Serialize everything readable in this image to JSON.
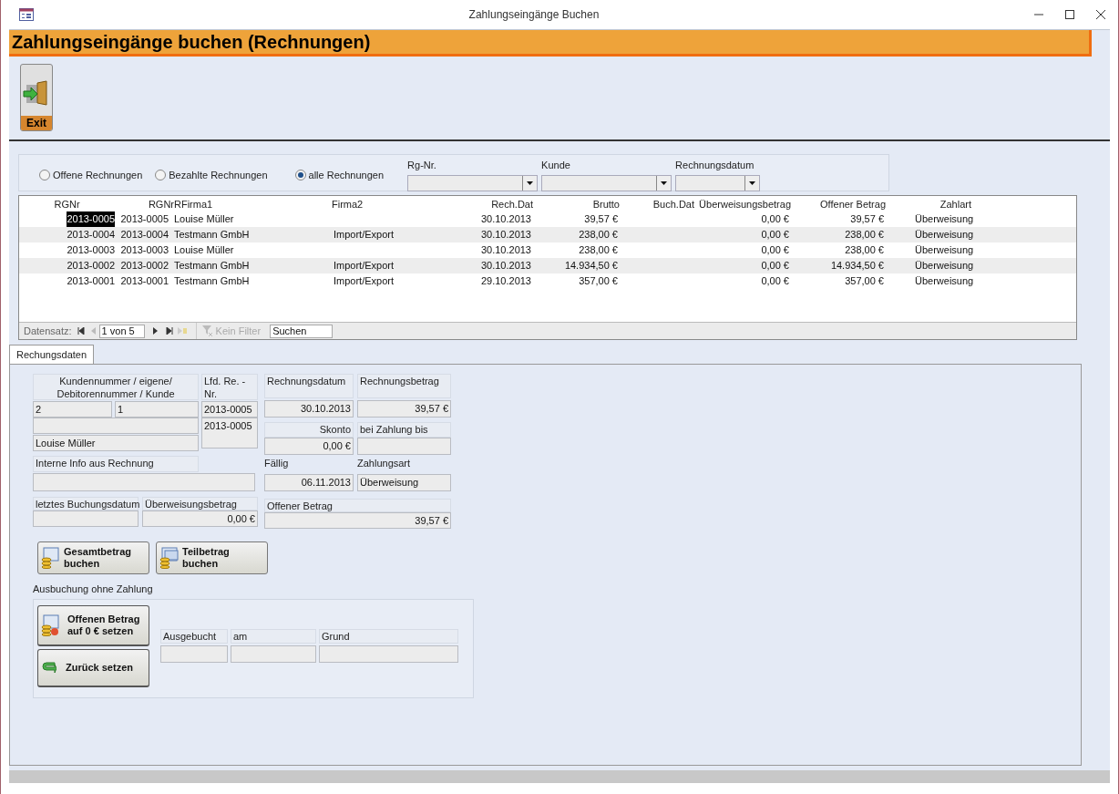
{
  "window": {
    "title": "Zahlungseingänge Buchen"
  },
  "header": {
    "title": "Zahlungseingänge buchen (Rechnungen)"
  },
  "toolbar": {
    "exit_label": "Exit"
  },
  "filter": {
    "radios": [
      {
        "label": "Offene Rechnungen",
        "selected": false
      },
      {
        "label": "Bezahlte Rechnungen",
        "selected": false
      },
      {
        "label": "alle Rechnungen",
        "selected": true
      }
    ],
    "dropdowns": [
      {
        "label": "Rg-Nr."
      },
      {
        "label": "Kunde"
      },
      {
        "label": "Rechnungsdatum"
      }
    ]
  },
  "table": {
    "columns": [
      "RGNr",
      "RGNr",
      "RFirma1",
      "Firma2",
      "Rech.Dat",
      "Brutto",
      "Buch.Dat",
      "Überweisungsbetrag",
      "Offener Betrag",
      "Zahlart"
    ],
    "rows": [
      {
        "selected": true,
        "cells": [
          "2013-0005",
          "2013-0005",
          "Louise Müller",
          "",
          "30.10.2013",
          "39,57 €",
          "",
          "0,00 €",
          "39,57 €",
          "Überweisung"
        ]
      },
      {
        "selected": false,
        "cells": [
          "2013-0004",
          "2013-0004",
          "Testmann GmbH",
          "Import/Export",
          "30.10.2013",
          "238,00 €",
          "",
          "0,00 €",
          "238,00 €",
          "Überweisung"
        ]
      },
      {
        "selected": false,
        "cells": [
          "2013-0003",
          "2013-0003",
          "Louise Müller",
          "",
          "30.10.2013",
          "238,00 €",
          "",
          "0,00 €",
          "238,00 €",
          "Überweisung"
        ]
      },
      {
        "selected": false,
        "cells": [
          "2013-0002",
          "2013-0002",
          "Testmann GmbH",
          "Import/Export",
          "30.10.2013",
          "14.934,50 €",
          "",
          "0,00 €",
          "14.934,50 €",
          "Überweisung"
        ]
      },
      {
        "selected": false,
        "cells": [
          "2013-0001",
          "2013-0001",
          "Testmann GmbH",
          "Import/Export",
          "29.10.2013",
          "357,00 €",
          "",
          "0,00 €",
          "357,00 €",
          "Überweisung"
        ]
      }
    ],
    "navigator": {
      "label": "Datensatz:",
      "position": "1 von 5",
      "filter": "Kein Filter",
      "search_placeholder": "Suchen"
    }
  },
  "tabs": [
    {
      "label": "Rechungsdaten",
      "selected": true
    }
  ],
  "detail": {
    "customer_label": "Kundennummer / eigene/ Debitorennummer / Kunde",
    "customer_number": "2",
    "debtor_number": "1",
    "customer_name": "Louise Müller",
    "invoice_no_label": "Lfd. Re. - Nr.",
    "invoice_no_1": "2013-0005",
    "invoice_no_2": "2013-0005",
    "internal_info_label": "Interne Info aus Rechnung",
    "last_booking_label": "letztes Buchungsdatum",
    "transfer_label": "Überweisungsbetrag",
    "transfer_value": "0,00 €",
    "invoice_date_label": "Rechnungsdatum",
    "invoice_date": "30.10.2013",
    "invoice_amount_label": "Rechnungsbetrag",
    "invoice_amount": "39,57 €",
    "discount_label": "Skonto",
    "discount": "0,00 €",
    "pay_until_label": "bei Zahlung bis",
    "due_label": "Fällig",
    "due": "06.11.2013",
    "payment_type_label": "Zahlungsart",
    "payment_type": "Überweisung",
    "open_label": "Offener Betrag",
    "open_amount": "39,57 €",
    "book_total": "Gesamtbetrag buchen",
    "book_partial": "Teilbetrag buchen",
    "writeoff_label": "Ausbuchung ohne Zahlung",
    "writeoff_button": "Offenen Betrag auf 0 € setzen",
    "reset_button": "Zurück setzen",
    "writeoff_fields": [
      {
        "label": "Ausgebucht"
      },
      {
        "label": "am"
      },
      {
        "label": "Grund"
      }
    ]
  }
}
